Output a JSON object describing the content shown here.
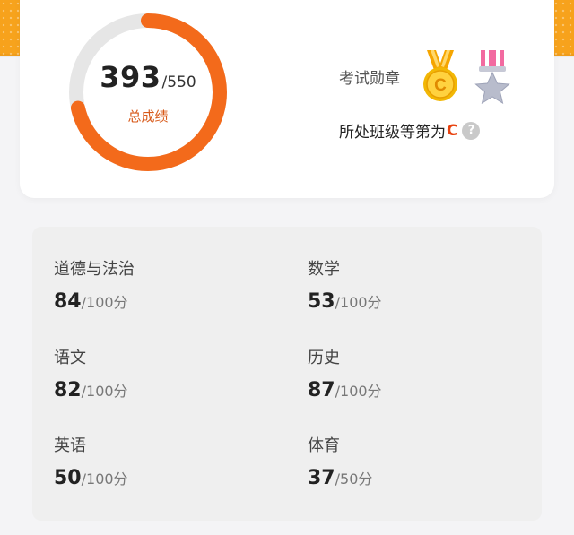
{
  "summary": {
    "score": "393",
    "total": "/550",
    "label": "总成绩",
    "progress": 0.7145,
    "ring_color": "#f36a1b",
    "ring_track_color": "#e6e6e6"
  },
  "badges": {
    "label": "考试勋章",
    "medals": [
      "gold-c-medal-icon",
      "silver-star-medal-icon"
    ]
  },
  "grade": {
    "prefix": "所处班级等第为",
    "letter": "C",
    "help_icon": "?"
  },
  "subjects": [
    {
      "name": "道德与法治",
      "score": "84",
      "max": "/100分"
    },
    {
      "name": "数学",
      "score": "53",
      "max": "/100分"
    },
    {
      "name": "语文",
      "score": "82",
      "max": "/100分"
    },
    {
      "name": "历史",
      "score": "87",
      "max": "/100分"
    },
    {
      "name": "英语",
      "score": "50",
      "max": "/100分"
    },
    {
      "name": "体育",
      "score": "37",
      "max": "/50分"
    }
  ]
}
